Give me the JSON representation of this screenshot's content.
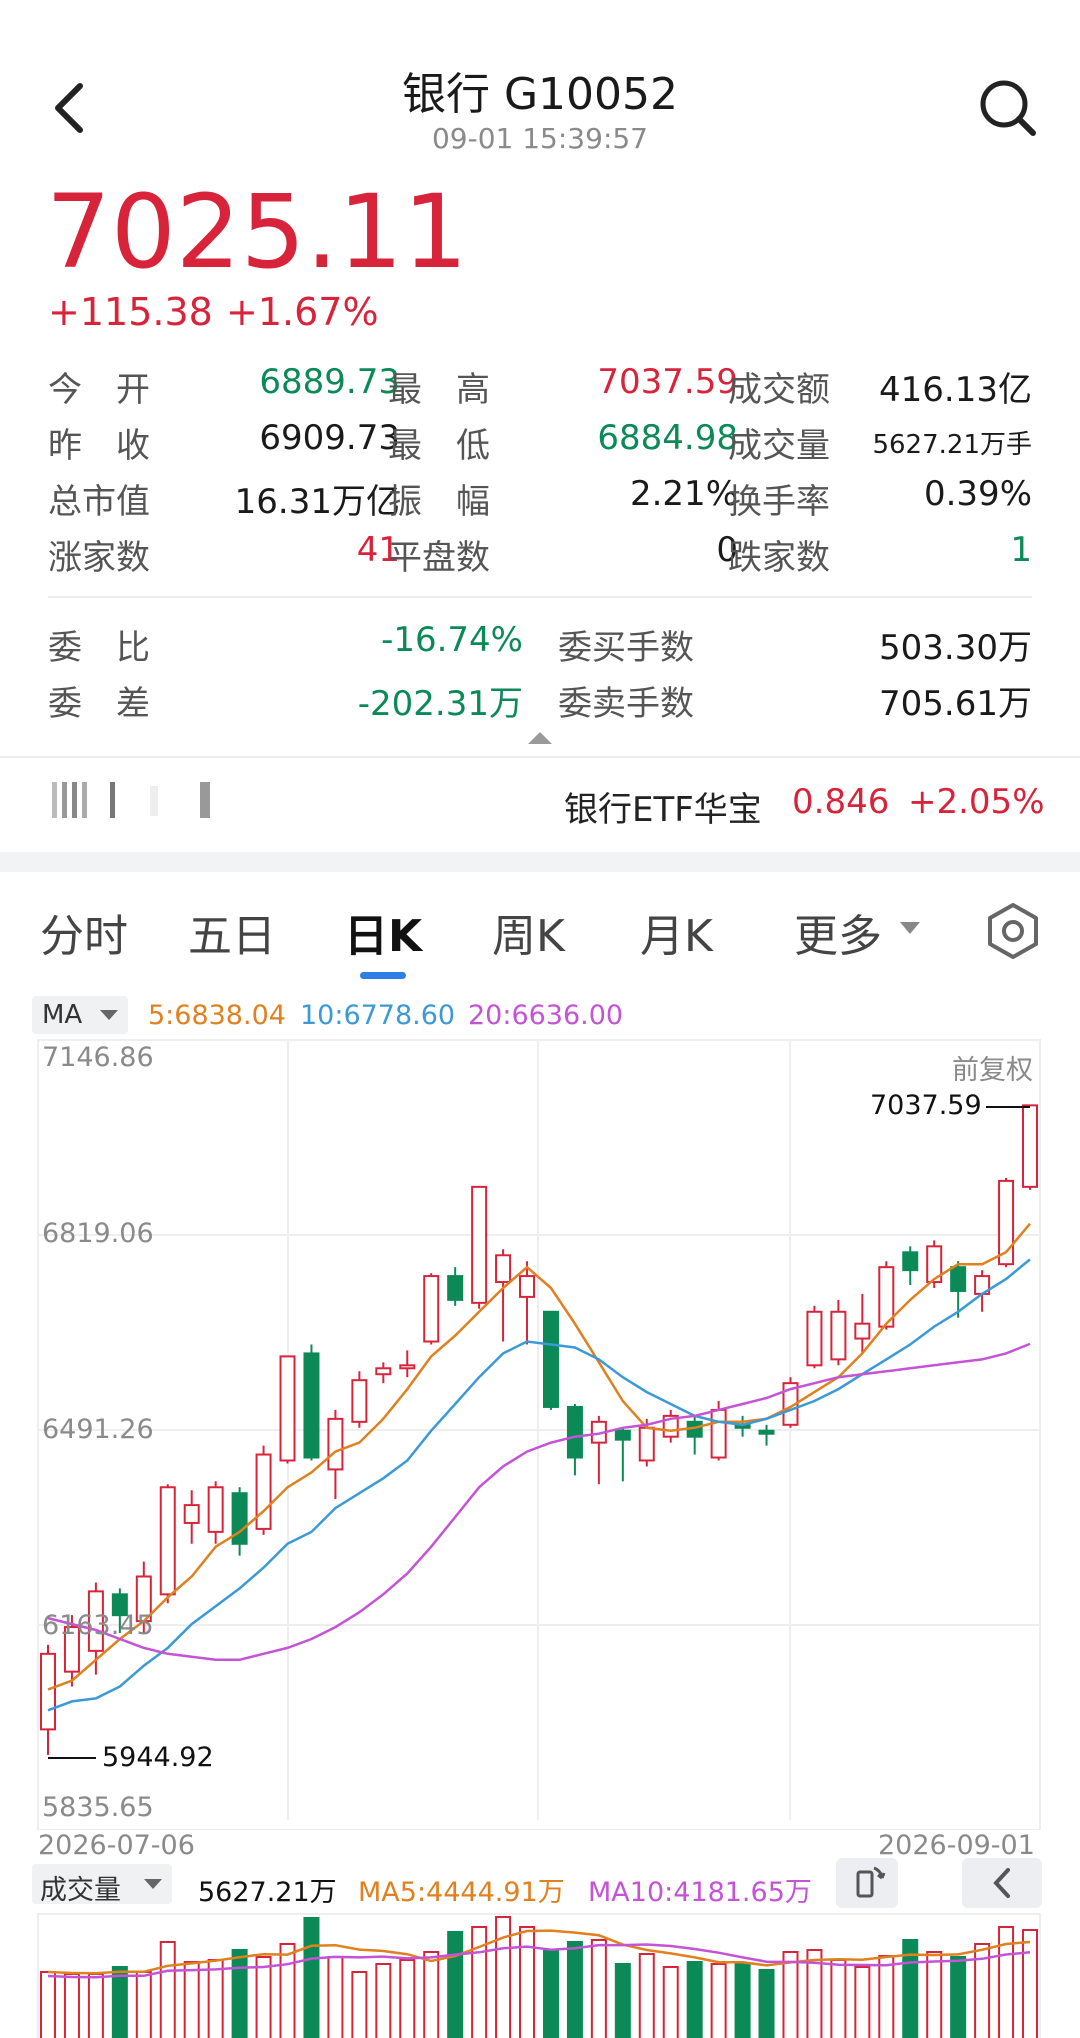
{
  "header": {
    "title": "银行 G10052",
    "time": "09-01 15:39:57"
  },
  "quote": {
    "price": "7025.11",
    "change": "+115.38",
    "change_pct": "+1.67%"
  },
  "stats": {
    "open_label": "今　开",
    "open": "6889.73",
    "high_label": "最　高",
    "high": "7037.59",
    "amount_label": "成交额",
    "amount": "416.13亿",
    "prev_label": "昨　收",
    "prev": "6909.73",
    "low_label": "最　低",
    "low": "6884.98",
    "volume_label": "成交量",
    "volume": "5627.21万手",
    "mcap_label": "总市值",
    "mcap": "16.31万亿",
    "amp_label": "振　幅",
    "amp": "2.21%",
    "turnover_label": "换手率",
    "turnover": "0.39%",
    "up_label": "涨家数",
    "up": "41",
    "flat_label": "平盘数",
    "flat": "0",
    "down_label": "跌家数",
    "down": "1"
  },
  "orders": {
    "ratio_label": "委　比",
    "ratio": "-16.74%",
    "buy_label": "委买手数",
    "buy": "503.30万",
    "diff_label": "委　差",
    "diff": "-202.31万",
    "sell_label": "委卖手数",
    "sell": "705.61万"
  },
  "etf": {
    "name": "银行ETF华宝",
    "price": "0.846",
    "change_pct": "+2.05%"
  },
  "tabs": [
    "分时",
    "五日",
    "日K",
    "周K",
    "月K",
    "更多"
  ],
  "active_tab": "日K",
  "ma_bar": {
    "selector": "MA",
    "ma5": "5:6838.04",
    "ma10": "10:6778.60",
    "ma20": "20:6636.00"
  },
  "chart_labels": {
    "y_ticks": [
      "7146.86",
      "6819.06",
      "6491.26",
      "6163.45",
      "5835.65"
    ],
    "fq": "前复权",
    "high_mark": "7037.59",
    "low_mark": "5944.92",
    "date_start": "2026-07-06",
    "date_end": "2026-09-01"
  },
  "volume_bar": {
    "selector": "成交量",
    "current": "5627.21万",
    "ma5": "MA5:4444.91万",
    "ma10": "MA10:4181.65万"
  },
  "colors": {
    "up": "#d8243a",
    "down": "#0b8a57",
    "ma5": "#e0801e",
    "ma10": "#3b9ad6",
    "ma20": "#c553d6",
    "accent": "#2d7fe3"
  },
  "chart_data": {
    "type": "candlestick",
    "ylim": [
      5835.65,
      7146.86
    ],
    "x_range": [
      "2026-07-06",
      "2026-09-01"
    ],
    "candles": [
      {
        "o": 5988,
        "c": 6115,
        "h": 6130,
        "l": 5945
      },
      {
        "o": 6085,
        "c": 6160,
        "h": 6180,
        "l": 6060
      },
      {
        "o": 6120,
        "c": 6220,
        "h": 6235,
        "l": 6080
      },
      {
        "o": 6215,
        "c": 6180,
        "h": 6225,
        "l": 6150
      },
      {
        "o": 6170,
        "c": 6245,
        "h": 6270,
        "l": 6150
      },
      {
        "o": 6215,
        "c": 6395,
        "h": 6400,
        "l": 6200
      },
      {
        "o": 6335,
        "c": 6365,
        "h": 6390,
        "l": 6300
      },
      {
        "o": 6320,
        "c": 6395,
        "h": 6405,
        "l": 6300
      },
      {
        "o": 6385,
        "c": 6300,
        "h": 6395,
        "l": 6280
      },
      {
        "o": 6325,
        "c": 6450,
        "h": 6465,
        "l": 6315
      },
      {
        "o": 6440,
        "c": 6615,
        "h": 6615,
        "l": 6435
      },
      {
        "o": 6620,
        "c": 6445,
        "h": 6635,
        "l": 6440
      },
      {
        "o": 6425,
        "c": 6510,
        "h": 6525,
        "l": 6375
      },
      {
        "o": 6505,
        "c": 6575,
        "h": 6590,
        "l": 6495
      },
      {
        "o": 6585,
        "c": 6595,
        "h": 6605,
        "l": 6570
      },
      {
        "o": 6595,
        "c": 6600,
        "h": 6625,
        "l": 6580
      },
      {
        "o": 6640,
        "c": 6750,
        "h": 6755,
        "l": 6635
      },
      {
        "o": 6750,
        "c": 6710,
        "h": 6765,
        "l": 6700
      },
      {
        "o": 6705,
        "c": 6900,
        "h": 6900,
        "l": 6695
      },
      {
        "o": 6740,
        "c": 6785,
        "h": 6795,
        "l": 6640
      },
      {
        "o": 6715,
        "c": 6750,
        "h": 6775,
        "l": 6635
      },
      {
        "o": 6690,
        "c": 6530,
        "h": 6690,
        "l": 6525
      },
      {
        "o": 6530,
        "c": 6445,
        "h": 6535,
        "l": 6415
      },
      {
        "o": 6470,
        "c": 6505,
        "h": 6515,
        "l": 6400
      },
      {
        "o": 6490,
        "c": 6475,
        "h": 6495,
        "l": 6405
      },
      {
        "o": 6440,
        "c": 6495,
        "h": 6510,
        "l": 6430
      },
      {
        "o": 6480,
        "c": 6515,
        "h": 6525,
        "l": 6470
      },
      {
        "o": 6505,
        "c": 6480,
        "h": 6515,
        "l": 6450
      },
      {
        "o": 6445,
        "c": 6525,
        "h": 6540,
        "l": 6440
      },
      {
        "o": 6500,
        "c": 6495,
        "h": 6515,
        "l": 6480
      },
      {
        "o": 6490,
        "c": 6485,
        "h": 6500,
        "l": 6465
      },
      {
        "o": 6500,
        "c": 6570,
        "h": 6580,
        "l": 6495
      },
      {
        "o": 6600,
        "c": 6690,
        "h": 6700,
        "l": 6595
      },
      {
        "o": 6610,
        "c": 6690,
        "h": 6710,
        "l": 6600
      },
      {
        "o": 6645,
        "c": 6670,
        "h": 6720,
        "l": 6620
      },
      {
        "o": 6665,
        "c": 6765,
        "h": 6775,
        "l": 6660
      },
      {
        "o": 6790,
        "c": 6760,
        "h": 6800,
        "l": 6735
      },
      {
        "o": 6740,
        "c": 6800,
        "h": 6810,
        "l": 6730
      },
      {
        "o": 6765,
        "c": 6725,
        "h": 6775,
        "l": 6680
      },
      {
        "o": 6720,
        "c": 6750,
        "h": 6760,
        "l": 6690
      },
      {
        "o": 6770,
        "c": 6910,
        "h": 6915,
        "l": 6765
      },
      {
        "o": 6900,
        "c": 7037,
        "h": 7037.59,
        "l": 6895
      }
    ],
    "ma5": [
      6055,
      6070,
      6105,
      6140,
      6170,
      6210,
      6245,
      6295,
      6320,
      6355,
      6395,
      6420,
      6455,
      6470,
      6510,
      6560,
      6615,
      6650,
      6690,
      6730,
      6765,
      6730,
      6670,
      6605,
      6540,
      6495,
      6490,
      6495,
      6505,
      6505,
      6510,
      6530,
      6555,
      6580,
      6620,
      6670,
      6710,
      6745,
      6770,
      6770,
      6790,
      6838
    ],
    "ma10": [
      6020,
      6035,
      6040,
      6060,
      6095,
      6125,
      6165,
      6195,
      6225,
      6260,
      6300,
      6320,
      6360,
      6385,
      6410,
      6440,
      6490,
      6535,
      6580,
      6620,
      6640,
      6635,
      6630,
      6610,
      6580,
      6555,
      6535,
      6515,
      6505,
      6500,
      6510,
      6525,
      6540,
      6560,
      6585,
      6610,
      6635,
      6665,
      6690,
      6720,
      6745,
      6778
    ],
    "ma20": [
      6175,
      6165,
      6155,
      6140,
      6125,
      6115,
      6110,
      6105,
      6105,
      6115,
      6125,
      6140,
      6160,
      6185,
      6215,
      6250,
      6295,
      6345,
      6395,
      6430,
      6455,
      6470,
      6480,
      6485,
      6495,
      6500,
      6510,
      6515,
      6525,
      6535,
      6545,
      6560,
      6570,
      6580,
      6585,
      6590,
      6595,
      6600,
      6605,
      6610,
      6620,
      6636
    ]
  }
}
